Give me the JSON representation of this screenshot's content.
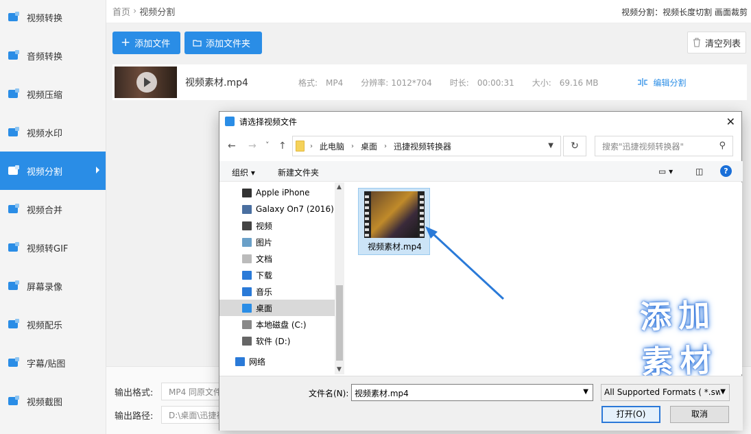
{
  "sidebar": {
    "items": [
      {
        "label": "视频转换",
        "icon": "video-convert-icon"
      },
      {
        "label": "音频转换",
        "icon": "audio-convert-icon"
      },
      {
        "label": "视频压缩",
        "icon": "video-compress-icon"
      },
      {
        "label": "视频水印",
        "icon": "video-watermark-icon"
      },
      {
        "label": "视频分割",
        "icon": "video-split-icon",
        "active": true
      },
      {
        "label": "视频合并",
        "icon": "video-merge-icon"
      },
      {
        "label": "视频转GIF",
        "icon": "gif-icon"
      },
      {
        "label": "屏幕录像",
        "icon": "screen-record-icon"
      },
      {
        "label": "视频配乐",
        "icon": "music-icon"
      },
      {
        "label": "字幕/贴图",
        "icon": "subtitle-sticker-icon"
      },
      {
        "label": "视频截图",
        "icon": "screenshot-icon"
      }
    ],
    "accent": "#2a8de6"
  },
  "header": {
    "crumb_home": "首页",
    "crumb_sep": "›",
    "crumb_current": "视频分割",
    "right_note": "视频分割：视频长度切割 画面裁剪"
  },
  "toolbar": {
    "add_file": "添加文件",
    "add_folder": "添加文件夹",
    "clear_list": "清空列表"
  },
  "file_row": {
    "name": "视频素材.mp4",
    "format_label": "格式:",
    "format_value": "MP4",
    "resolution_label": "分辨率:",
    "resolution_value": "1012*704",
    "duration_label": "时长:",
    "duration_value": "00:00:31",
    "size_label": "大小:",
    "size_value": "69.16 MB",
    "edit_split": "编辑分割"
  },
  "output": {
    "format_label": "输出格式:",
    "format_value": "MP4  同原文件",
    "path_label": "输出路径:",
    "path_value": "D:\\桌面\\迅捷视频转换器"
  },
  "dialog": {
    "title": "请选择视频文件",
    "close": "✕",
    "nav_back": "←",
    "nav_forward": "→",
    "nav_recent": "˅",
    "nav_up": "↑",
    "breadcrumb": [
      "此电脑",
      "桌面",
      "迅捷视频转换器"
    ],
    "breadcrumb_sep": "›",
    "refresh": "↻",
    "search_placeholder": "搜索\"迅捷视频转换器\"",
    "organize": "组织 ▾",
    "new_folder": "新建文件夹",
    "help": "?",
    "nav_items": [
      {
        "label": "Apple iPhone",
        "icon": "phone-icon"
      },
      {
        "label": "Galaxy On7 (2016)",
        "icon": "android-phone-icon"
      },
      {
        "label": "视频",
        "icon": "video-folder-icon"
      },
      {
        "label": "图片",
        "icon": "pictures-folder-icon"
      },
      {
        "label": "文档",
        "icon": "documents-folder-icon"
      },
      {
        "label": "下载",
        "icon": "download-icon"
      },
      {
        "label": "音乐",
        "icon": "music-note-icon"
      },
      {
        "label": "桌面",
        "icon": "desktop-icon",
        "selected": true
      },
      {
        "label": "本地磁盘 (C:)",
        "icon": "disk-c-icon"
      },
      {
        "label": "软件 (D:)",
        "icon": "disk-d-icon"
      },
      {
        "label": "网络",
        "icon": "network-icon"
      }
    ],
    "file_tile": {
      "name": "视频素材.mp4"
    },
    "annotation": "添加素材",
    "filename_label": "文件名(N):",
    "filename_value": "视频素材.mp4",
    "format_filter": "All Supported Formats ( *.sw",
    "open_button": "打开(O)",
    "cancel_button": "取消"
  }
}
